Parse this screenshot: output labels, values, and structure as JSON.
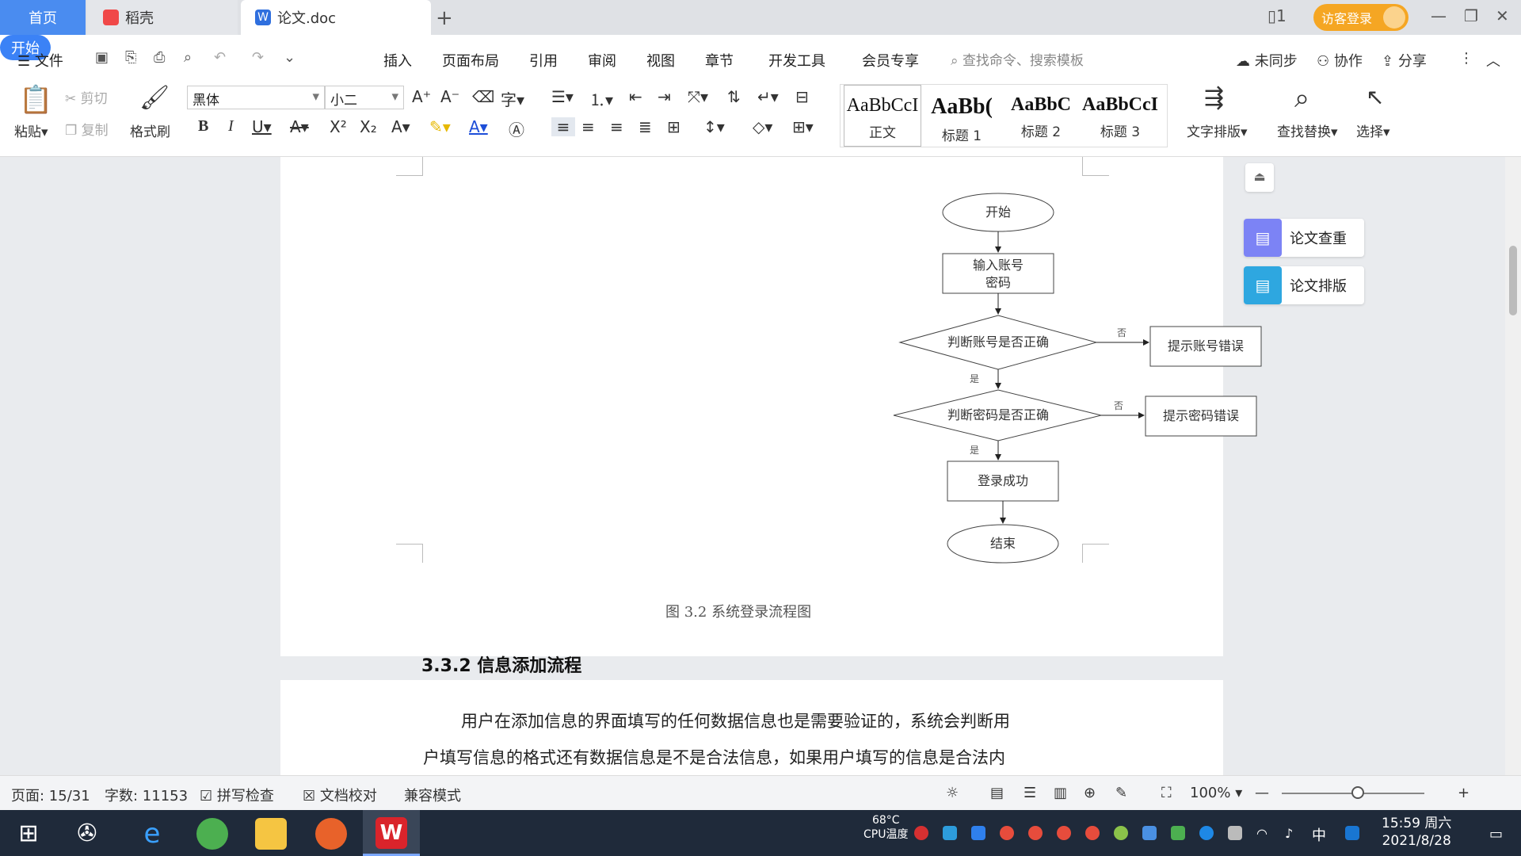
{
  "tabs": {
    "home": "首页",
    "daoke": "稻壳",
    "doc": "论文.doc"
  },
  "topbar": {
    "login": "访客登录"
  },
  "menu": {
    "file": "文件",
    "start": "开始",
    "insert": "插入",
    "layout": "页面布局",
    "reference": "引用",
    "review": "审阅",
    "view": "视图",
    "chapter": "章节",
    "devtools": "开发工具",
    "member": "会员专享",
    "search_placeholder": "查找命令、搜索模板",
    "unsynced": "未同步",
    "collab": "协作",
    "share": "分享"
  },
  "ribbon": {
    "paste": "粘贴",
    "cut": "剪切",
    "copy": "复制",
    "format_painter": "格式刷",
    "font": "黑体",
    "size": "小二",
    "styles": [
      {
        "sample": "AaBbCcI",
        "name": "正文"
      },
      {
        "sample": "AaBb(",
        "name": "标题 1"
      },
      {
        "sample": "AaBbC",
        "name": "标题 2"
      },
      {
        "sample": "AaBbCcI",
        "name": "标题 3"
      }
    ],
    "text_layout": "文字排版",
    "find_replace": "查找替换",
    "select": "选择"
  },
  "flowchart": {
    "start": "开始",
    "input_line1": "输入账号",
    "input_line2": "密码",
    "check_account": "判断账号是否正确",
    "account_error": "提示账号错误",
    "check_password": "判断密码是否正确",
    "password_error": "提示密码错误",
    "success": "登录成功",
    "end": "结束",
    "no": "否",
    "yes": "是"
  },
  "document": {
    "caption": "图 3.2    系统登录流程图",
    "heading": "3.3.2 信息添加流程",
    "para_line1": "用户在添加信息的界面填写的任何数据信息也是需要验证的，系统会判断用",
    "para_line2": "户填写信息的格式还有数据信息是不是合法信息，如果用户填写的信息是合法内"
  },
  "side_panel": {
    "check": "论文查重",
    "format": "论文排版"
  },
  "status": {
    "page": "页面: 15/31",
    "words": "字数: 11153",
    "spell": "拼写检查",
    "proof": "文档校对",
    "compat": "兼容模式",
    "zoom": "100%"
  },
  "taskbar": {
    "cpu_temp": "68°C",
    "cpu_label": "CPU温度",
    "ime": "中",
    "time": "15:59 周六",
    "date": "2021/8/28"
  }
}
